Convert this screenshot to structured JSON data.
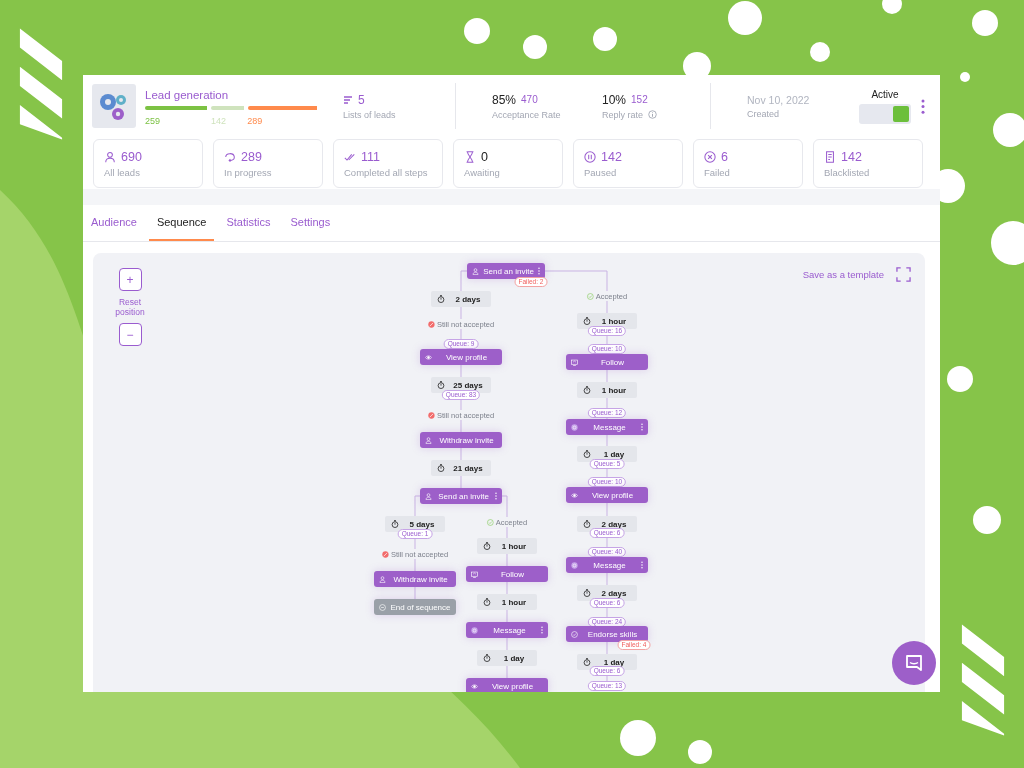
{
  "campaign": {
    "name": "Lead generation",
    "segments": [
      {
        "value": "259",
        "color": "#7cc243"
      },
      {
        "value": "142",
        "color": "#cfe3bd"
      },
      {
        "value": "289",
        "color": "#ff8a4c"
      }
    ]
  },
  "lists": {
    "value": "5",
    "label": "Lists of leads"
  },
  "rates": [
    {
      "percent": "85%",
      "count": "470",
      "label": "Acceptance Rate",
      "info": false
    },
    {
      "percent": "10%",
      "count": "152",
      "label": "Reply rate",
      "info": true
    }
  ],
  "created": {
    "date": "Nov 10, 2022",
    "label": "Created"
  },
  "status": {
    "label": "Active",
    "on": true
  },
  "stats": [
    {
      "kind": "leads",
      "value": "690",
      "label": "All leads",
      "highlighted": true
    },
    {
      "kind": "progress",
      "value": "289",
      "label": "In progress",
      "highlighted": true
    },
    {
      "kind": "completed",
      "value": "111",
      "label": "Completed all steps",
      "highlighted": true
    },
    {
      "kind": "awaiting",
      "value": "0",
      "label": "Awaiting",
      "highlighted": false
    },
    {
      "kind": "paused",
      "value": "142",
      "label": "Paused",
      "highlighted": true
    },
    {
      "kind": "failed",
      "value": "6",
      "label": "Failed",
      "highlighted": true
    },
    {
      "kind": "blacklisted",
      "value": "142",
      "label": "Blacklisted",
      "highlighted": true
    }
  ],
  "tabs": [
    {
      "label": "Audience",
      "selected": false
    },
    {
      "label": "Sequence",
      "selected": true
    },
    {
      "label": "Statistics",
      "selected": false
    },
    {
      "label": "Settings",
      "selected": false
    }
  ],
  "canvas": {
    "zoom_in": "+",
    "reset": "Reset position",
    "zoom_out": "−",
    "save": "Save as a template"
  },
  "sequence": {
    "root": {
      "kind": "invite",
      "label": "Send an invite",
      "menu": true,
      "failed": "Failed: 2",
      "branches": [
        {
          "steps": [
            {
              "kind": "delay",
              "label": "2 days"
            },
            {
              "kind": "condition",
              "label": "Still not accepted",
              "accepted": false
            },
            {
              "kind": "queue",
              "label": "Queue: 9"
            },
            {
              "kind": "view",
              "label": "View profile"
            },
            {
              "kind": "delay",
              "label": "25 days"
            },
            {
              "kind": "queue",
              "label": "Queue: 83"
            },
            {
              "kind": "condition",
              "label": "Still not accepted",
              "accepted": false
            },
            {
              "kind": "withdraw",
              "label": "Withdraw invite"
            },
            {
              "kind": "delay",
              "label": "21 days"
            },
            {
              "kind": "invite",
              "label": "Send an invite",
              "menu": true,
              "branches": [
                {
                  "steps": [
                    {
                      "kind": "delay",
                      "label": "5 days"
                    },
                    {
                      "kind": "queue",
                      "label": "Queue: 1"
                    },
                    {
                      "kind": "condition",
                      "label": "Still not accepted",
                      "accepted": false
                    },
                    {
                      "kind": "withdraw",
                      "label": "Withdraw invite"
                    },
                    {
                      "kind": "end",
                      "label": "End of sequence"
                    }
                  ]
                },
                {
                  "steps": [
                    {
                      "kind": "condition",
                      "label": "Accepted",
                      "accepted": true
                    },
                    {
                      "kind": "delay",
                      "label": "1 hour"
                    },
                    {
                      "kind": "follow",
                      "label": "Follow"
                    },
                    {
                      "kind": "delay",
                      "label": "1 hour"
                    },
                    {
                      "kind": "message",
                      "label": "Message",
                      "menu": true
                    },
                    {
                      "kind": "delay",
                      "label": "1 day"
                    },
                    {
                      "kind": "view",
                      "label": "View profile"
                    }
                  ]
                }
              ]
            }
          ]
        },
        {
          "steps": [
            {
              "kind": "condition",
              "label": "Accepted",
              "accepted": true
            },
            {
              "kind": "delay",
              "label": "1 hour"
            },
            {
              "kind": "queue",
              "label": "Queue: 16"
            },
            {
              "kind": "queue",
              "label": "Queue: 10"
            },
            {
              "kind": "follow",
              "label": "Follow"
            },
            {
              "kind": "delay",
              "label": "1 hour"
            },
            {
              "kind": "queue",
              "label": "Queue: 12"
            },
            {
              "kind": "message",
              "label": "Message",
              "menu": true
            },
            {
              "kind": "delay",
              "label": "1 day"
            },
            {
              "kind": "queue",
              "label": "Queue: 5"
            },
            {
              "kind": "queue",
              "label": "Queue: 10"
            },
            {
              "kind": "view",
              "label": "View profile"
            },
            {
              "kind": "delay",
              "label": "2 days"
            },
            {
              "kind": "queue",
              "label": "Queue: 6"
            },
            {
              "kind": "queue",
              "label": "Queue: 40"
            },
            {
              "kind": "message",
              "label": "Message",
              "menu": true
            },
            {
              "kind": "delay",
              "label": "2 days"
            },
            {
              "kind": "queue",
              "label": "Queue: 6"
            },
            {
              "kind": "queue",
              "label": "Queue: 24"
            },
            {
              "kind": "endorse",
              "label": "Endorse skills",
              "failed": "Failed: 4"
            },
            {
              "kind": "delay",
              "label": "1 day"
            },
            {
              "kind": "queue",
              "label": "Queue: 6"
            },
            {
              "kind": "queue",
              "label": "Queue: 13"
            }
          ]
        }
      ]
    }
  }
}
